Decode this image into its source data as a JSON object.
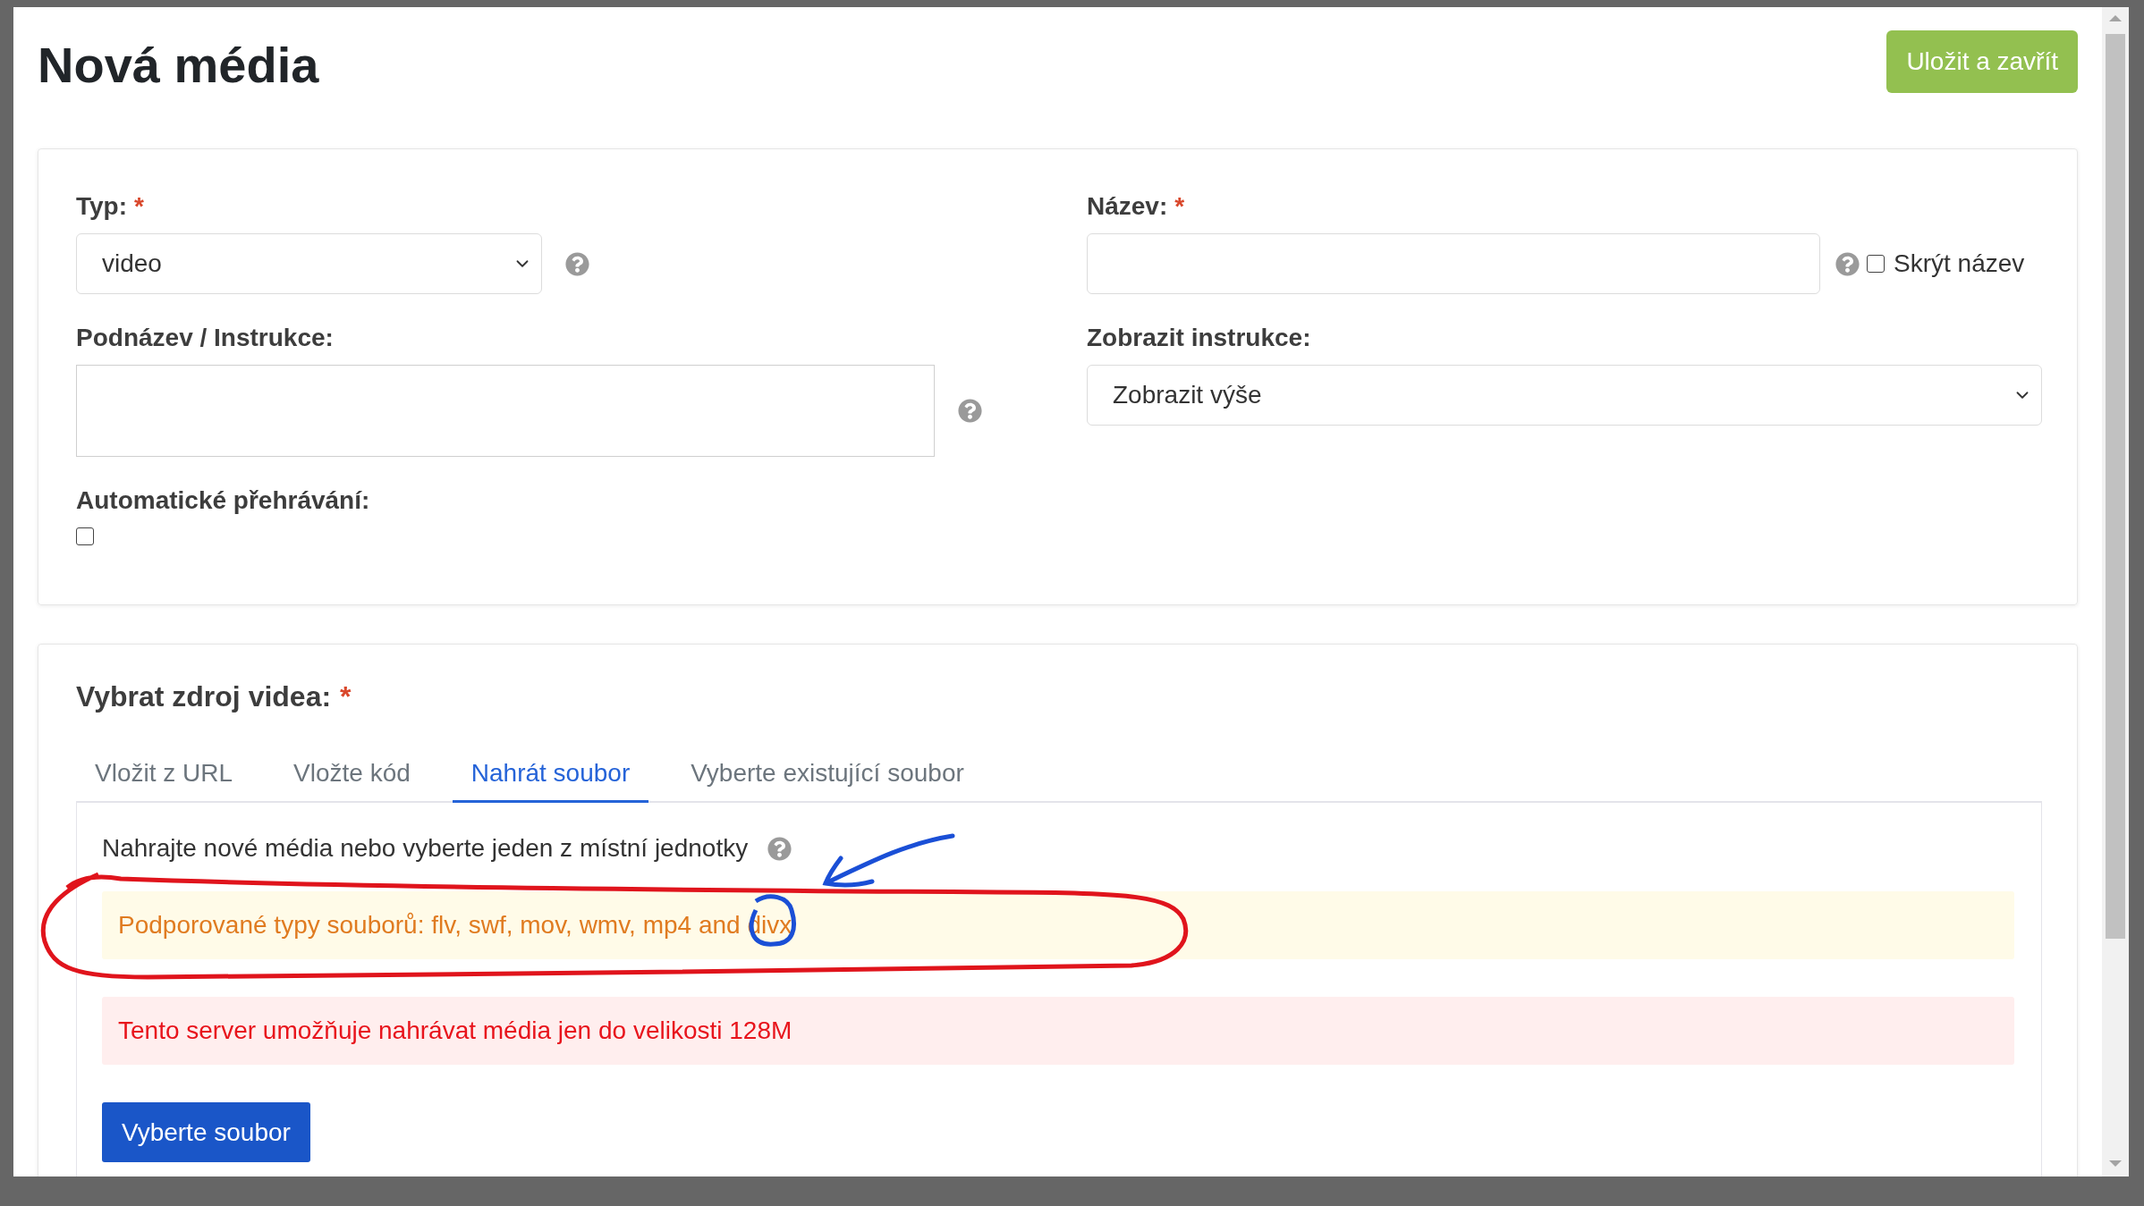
{
  "dialog": {
    "title": "Nová média",
    "save_button": "Uložit a zavřít"
  },
  "details": {
    "type": {
      "label": "Typ:",
      "required_mark": "*",
      "value": "video"
    },
    "name": {
      "label": "Název:",
      "required_mark": "*",
      "hide_option": {
        "label": "Skrýt název",
        "checked": false
      }
    },
    "subtitle": {
      "label": "Podnázev / Instrukce:"
    },
    "show_instructions": {
      "label": "Zobrazit instrukce:",
      "value": "Zobrazit výše"
    },
    "autoplay": {
      "label": "Automatické přehrávání:",
      "checked": false
    }
  },
  "source": {
    "label": "Vybrat zdroj videa:",
    "required_mark": "*",
    "tabs": [
      {
        "label": "Vložit z URL",
        "selected": false
      },
      {
        "label": "Vložte kód",
        "selected": false
      },
      {
        "label": "Nahrát soubor",
        "selected": true
      },
      {
        "label": "Vyberte existující soubor",
        "selected": false
      }
    ],
    "description": "Nahrajte nové média nebo vyberte jeden z místní jednotky",
    "alerts": [
      {
        "kind": "warning",
        "text": "Podporované typy souborů: flv, swf, mov, wmv, mp4 and divx"
      },
      {
        "kind": "danger",
        "text": "Tento server umožňuje nahrávat média jen do velikosti 128M"
      }
    ],
    "button": "Vyberte soubor"
  },
  "annotations": [
    {
      "kind": "ellipse",
      "color": "#e0141c"
    },
    {
      "kind": "arrow",
      "color": "#1a4fd6"
    },
    {
      "kind": "circle",
      "color": "#1a4fd6"
    }
  ]
}
